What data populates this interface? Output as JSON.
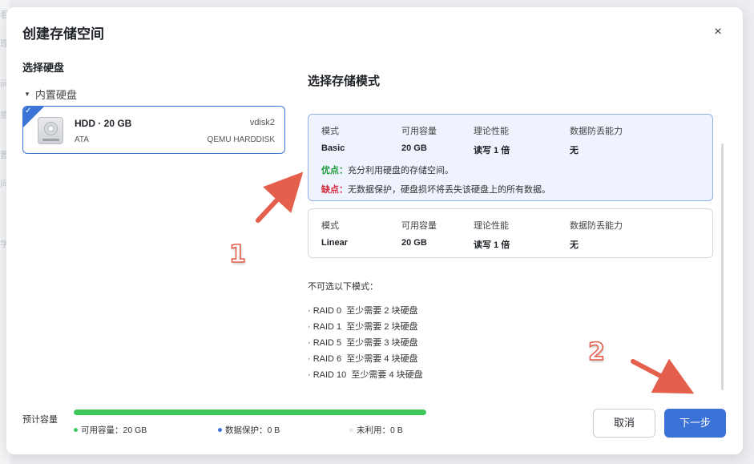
{
  "background": {
    "side_chars": [
      "看",
      "理",
      "间",
      "盾",
      "置",
      "问",
      "学"
    ]
  },
  "dialog": {
    "title": "创建存储空间",
    "close_label": "×"
  },
  "left": {
    "title": "选择硬盘",
    "group_label": "内置硬盘",
    "disk": {
      "name": "HDD · 20 GB",
      "interface": "ATA",
      "device": "vdisk2",
      "model": "QEMU HARDDISK",
      "selected": true
    }
  },
  "right": {
    "title": "选择存储模式",
    "headers": [
      "模式",
      "可用容量",
      "理论性能",
      "数据防丢能力"
    ],
    "modes": [
      {
        "mode": "Basic",
        "capacity": "20 GB",
        "performance": "读写 1 倍",
        "protection": "无",
        "pro_label": "优点：",
        "pro_text": "充分利用硬盘的存储空间。",
        "con_label": "缺点：",
        "con_text": "无数据保护，硬盘损坏将丢失该硬盘上的所有数据。",
        "selected": true
      },
      {
        "mode": "Linear",
        "capacity": "20 GB",
        "performance": "读写 1 倍",
        "protection": "无",
        "selected": false
      }
    ],
    "unavailable_title": "不可选以下模式：",
    "unavailable": [
      "· RAID 0  至少需要 2 块硬盘",
      "· RAID 1  至少需要 2 块硬盘",
      "· RAID 5  至少需要 3 块硬盘",
      "· RAID 6  至少需要 4 块硬盘",
      "· RAID 10  至少需要 4 块硬盘"
    ]
  },
  "footer": {
    "estimate_label": "预计容量",
    "progress_fraction": 1.0,
    "legend": [
      {
        "label": "可用容量：20 GB",
        "color": "#3cc95a"
      },
      {
        "label": "数据保护：0 B",
        "color": "#3b72d8"
      },
      {
        "label": "未利用：0 B",
        "color": "#e4e6ea"
      }
    ],
    "cancel_label": "取消",
    "next_label": "下一步"
  },
  "annotations": {
    "marker_1": "1",
    "marker_2": "2",
    "color": "#e45f4c"
  }
}
